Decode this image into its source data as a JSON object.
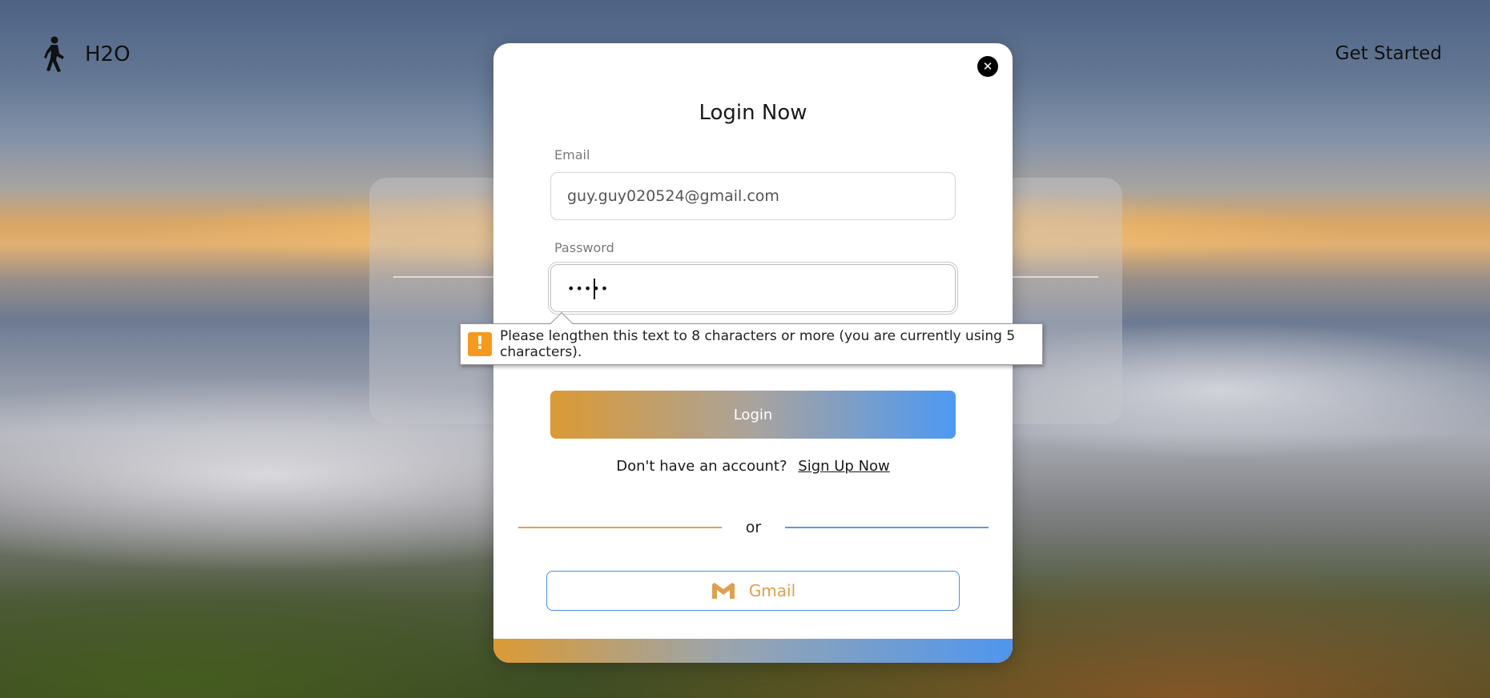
{
  "header": {
    "brand_icon": "walking-person-icon",
    "brand_name": "H2O",
    "get_started_label": "Get Started"
  },
  "login_modal": {
    "title": "Login Now",
    "close_icon": "close-icon",
    "email_label": "Email",
    "email_value": "guy.guy020524@gmail.com",
    "password_label": "Password",
    "password_value": "•••••",
    "login_button_label": "Login",
    "signup_prompt": "Don't have an account?",
    "signup_link_label": "Sign Up Now",
    "divider_text": "or",
    "gmail_icon": "gmail-icon",
    "gmail_button_label": "Gmail"
  },
  "validation_tooltip": {
    "icon": "warning-icon",
    "icon_glyph": "!",
    "message": "Please lengthen this text to 8 characters or more (you are currently using 5 characters)."
  },
  "colors": {
    "accent_orange": "#dc9a34",
    "accent_blue": "#4e99f3",
    "warning": "#f59a1c"
  }
}
